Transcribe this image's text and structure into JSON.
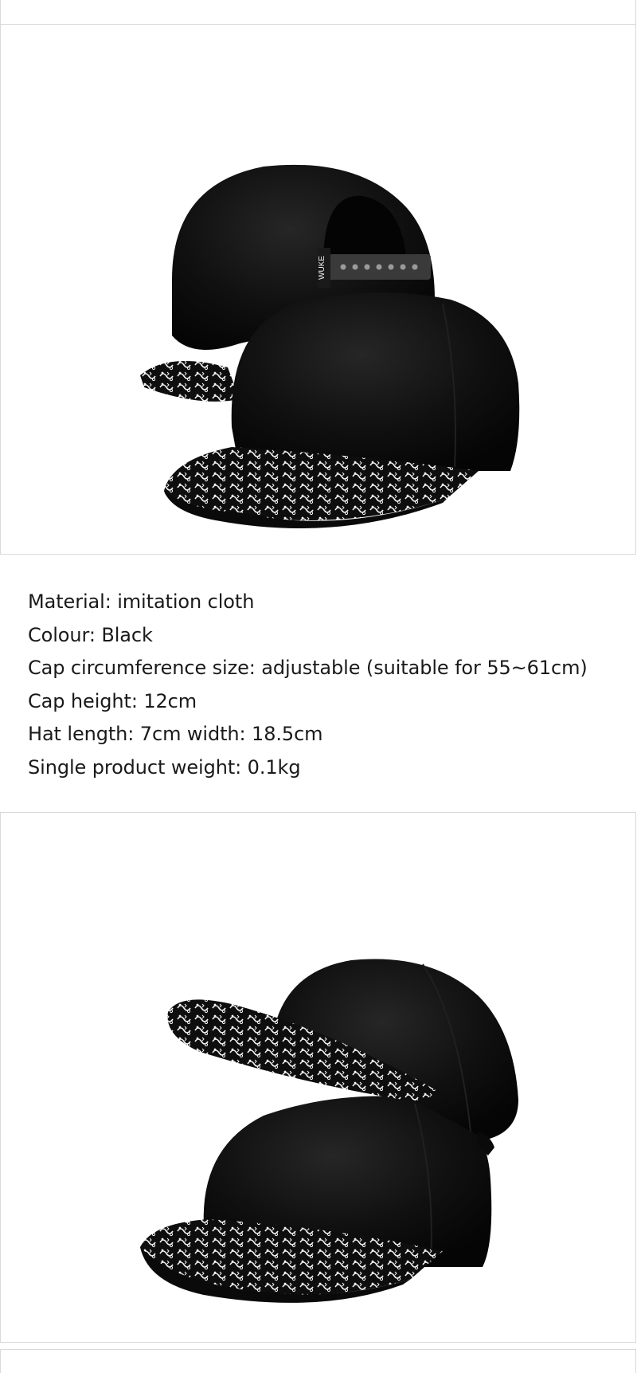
{
  "specs": {
    "material": "Material: imitation cloth",
    "colour": "Colour: Black",
    "circumference": "Cap circumference size: adjustable (suitable for 55~61cm)",
    "height": "Cap height: 12cm",
    "dimensions": "Hat length: 7cm width: 18.5cm",
    "weight": "Single product weight: 0.1kg"
  },
  "photos": {
    "brand_tag": "WUKE"
  },
  "colors": {
    "cap_black": "#0c0c0c",
    "frame_border": "#d9d9d9",
    "paisley_white": "#f2f2f2"
  }
}
